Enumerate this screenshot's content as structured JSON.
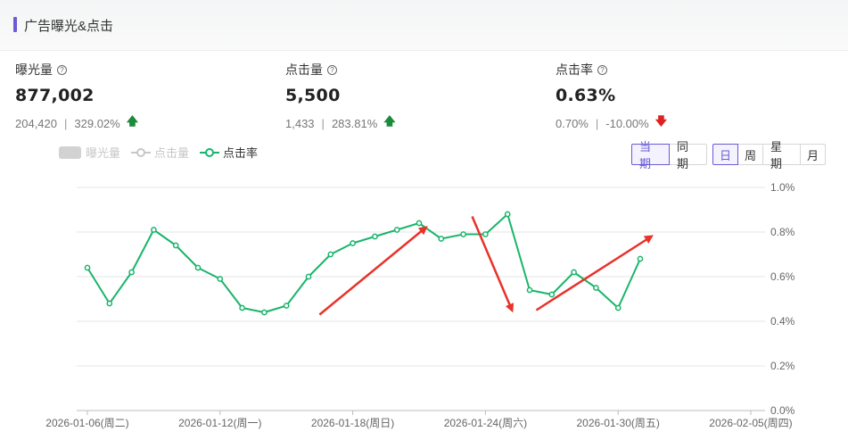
{
  "header": {
    "title": "广告曝光&点击"
  },
  "kpis": [
    {
      "label": "曝光量",
      "value": "877,002",
      "prev": "204,420",
      "change": "329.02%",
      "trend": "up"
    },
    {
      "label": "点击量",
      "value": "5,500",
      "prev": "1,433",
      "change": "283.81%",
      "trend": "up"
    },
    {
      "label": "点击率",
      "value": "0.63%",
      "prev": "0.70%",
      "change": "-10.00%",
      "trend": "down"
    }
  ],
  "legend": {
    "exposure": "曝光量",
    "clicks": "点击量",
    "ctr": "点击率"
  },
  "compare_buttons": [
    "当期",
    "同期"
  ],
  "period_buttons": [
    "日",
    "周",
    "星期",
    "月"
  ],
  "colors": {
    "accent": "#6a5bd6",
    "line": "#19b56b",
    "up": "#1b8a3c",
    "down": "#e02020",
    "annotation": "#e8322a"
  },
  "chart_data": {
    "type": "line",
    "title": "",
    "series": [
      {
        "name": "点击率",
        "values": [
          0.64,
          0.48,
          0.62,
          0.81,
          0.74,
          0.64,
          0.59,
          0.46,
          0.44,
          0.47,
          0.6,
          0.7,
          0.75,
          0.78,
          0.81,
          0.84,
          0.77,
          0.79,
          0.79,
          0.88,
          0.54,
          0.52,
          0.62,
          0.55,
          0.46,
          0.68
        ]
      }
    ],
    "x_tick_labels": [
      "2026-01-06(周二)",
      "2026-01-12(周一)",
      "2026-01-18(周日)",
      "2026-01-24(周六)",
      "2026-01-30(周五)",
      "2026-02-05(周四)"
    ],
    "y_tick_labels": [
      "0.0%",
      "0.2%",
      "0.4%",
      "0.6%",
      "0.8%",
      "1.0%"
    ],
    "ylim": [
      0,
      1.0
    ],
    "y_unit": "%",
    "grid": true,
    "legend_position": "top-left",
    "annotations": [
      {
        "type": "arrow",
        "direction": "up",
        "from_index": 10.5,
        "from_value": 0.43,
        "to_index": 15.3,
        "to_value": 0.82
      },
      {
        "type": "arrow",
        "direction": "down",
        "from_index": 17.4,
        "from_value": 0.87,
        "to_index": 19.2,
        "to_value": 0.45
      },
      {
        "type": "arrow",
        "direction": "up",
        "from_index": 20.3,
        "from_value": 0.45,
        "to_index": 25.5,
        "to_value": 0.78
      }
    ]
  }
}
